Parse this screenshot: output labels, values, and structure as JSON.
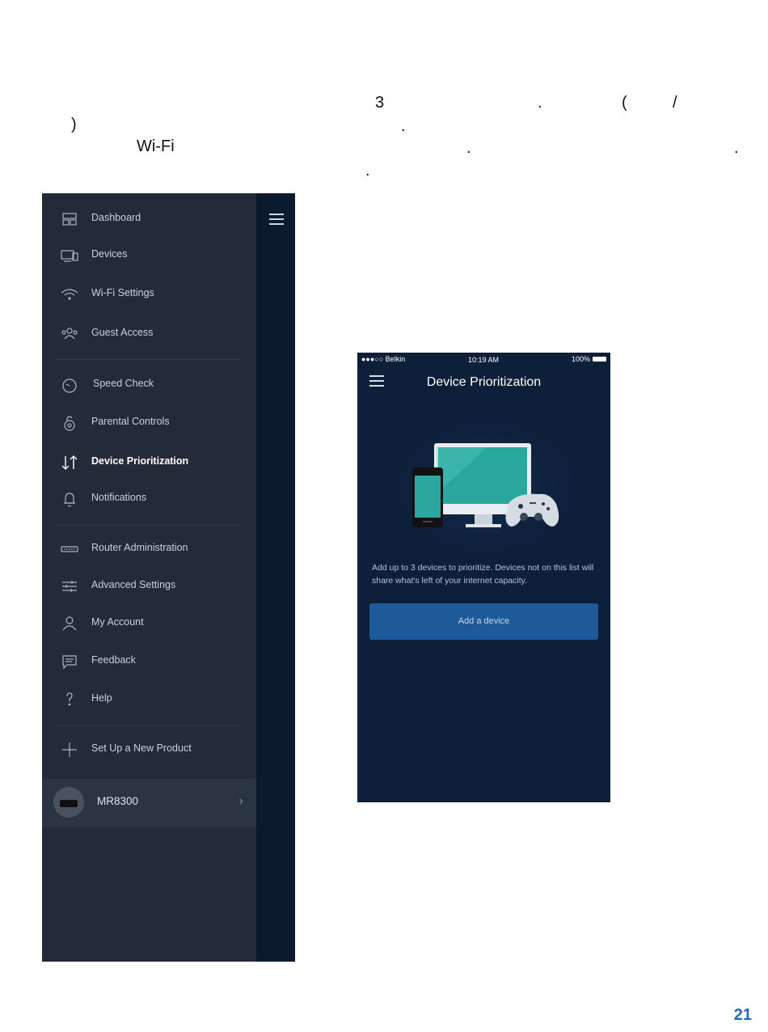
{
  "paragraph": {
    "fragments": [
      "3",
      ".",
      "(",
      "/",
      ")",
      ".",
      "Wi-Fi",
      ".",
      ".",
      "."
    ]
  },
  "menu": {
    "items": [
      {
        "label": "Dashboard"
      },
      {
        "label": "Devices"
      },
      {
        "label": "Wi-Fi Settings"
      },
      {
        "label": "Guest Access"
      },
      {
        "label": "Speed Check"
      },
      {
        "label": "Parental Controls"
      },
      {
        "label": "Device Prioritization"
      },
      {
        "label": "Notifications"
      },
      {
        "label": "Router Administration"
      },
      {
        "label": "Advanced Settings"
      },
      {
        "label": "My Account"
      },
      {
        "label": "Feedback"
      },
      {
        "label": "Help"
      },
      {
        "label": "Set Up a New Product"
      }
    ],
    "active_item": "Device Prioritization",
    "device": {
      "name": "MR8300"
    }
  },
  "phone": {
    "status": {
      "carrier": "●●●○○ Belkin",
      "time": "10:19 AM",
      "battery": "100%"
    },
    "title": "Device Prioritization",
    "description": "Add up to 3 devices to prioritize. Devices not on this list will share what's left of your internet capacity.",
    "add_button": "Add a device"
  },
  "colors": {
    "menu_bg": "#232b39",
    "phone_bg": "#0e1f3a",
    "button": "#1d5a97",
    "page_number": "#1f6fb8"
  },
  "page_number": "21"
}
